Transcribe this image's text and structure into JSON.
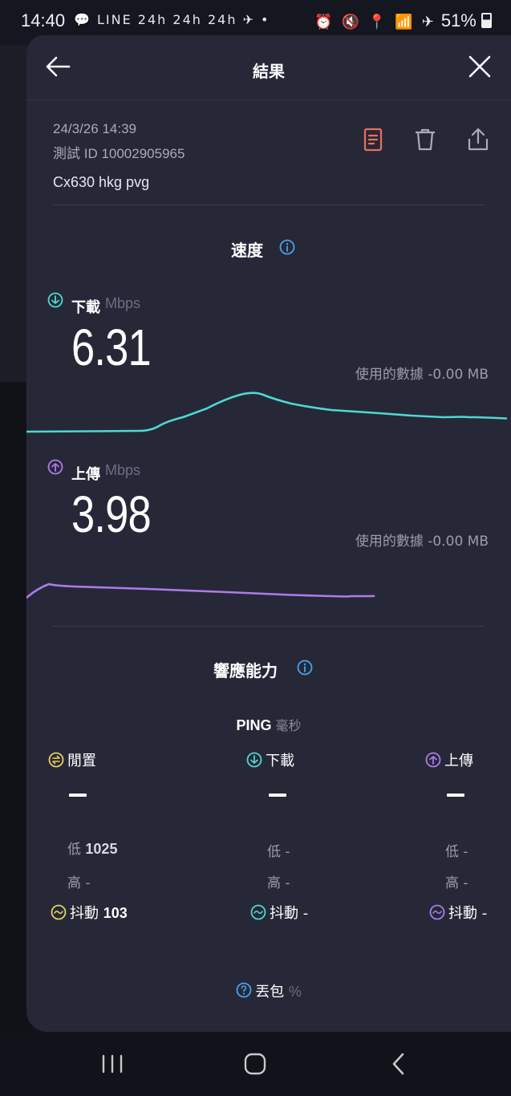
{
  "status_bar": {
    "time": "14:40",
    "notification_icons": "💬 LINE 24h 24h 24h ✈ •",
    "right_icons": "⏰ 🔇 📍 📶 ✈",
    "battery": "51%"
  },
  "header": {
    "title": "結果",
    "back_icon": "arrow-left-icon",
    "close_icon": "close-icon"
  },
  "result": {
    "date": "24/3/26 14:39",
    "test_id": "測試 ID 10002905965",
    "name": "Cx630 hkg pvg",
    "actions": [
      "document-icon",
      "trash-icon",
      "share-icon"
    ]
  },
  "speed": {
    "title": "速度",
    "download": {
      "label": "下載",
      "unit": "Mbps",
      "value": "6.31",
      "data_used": "使用的數據 -0.00 MB"
    },
    "upload": {
      "label": "上傳",
      "unit": "Mbps",
      "value": "3.98",
      "data_used": "使用的數據 -0.00 MB"
    }
  },
  "responsiveness": {
    "title": "響應能力",
    "ping_title": "PING",
    "ping_unit": "毫秒",
    "columns": [
      {
        "label": "閒置",
        "value": "",
        "low_label": "低",
        "low": "1025",
        "high_label": "高",
        "high": "-",
        "jitter_label": "抖動",
        "jitter": "103",
        "color": "#e8d25c"
      },
      {
        "label": "下載",
        "value": "",
        "low_label": "低",
        "low": "-",
        "high_label": "高",
        "high": "-",
        "jitter_label": "抖動",
        "jitter": "-",
        "color": "#4fd8d2"
      },
      {
        "label": "上傳",
        "value": "",
        "low_label": "低",
        "low": "-",
        "high_label": "高",
        "high": "-",
        "jitter_label": "抖動",
        "jitter": "-",
        "color": "#b07ae8"
      }
    ]
  },
  "packet_loss": {
    "label": "丟包",
    "unit": "%"
  },
  "colors": {
    "download": "#4fd8d2",
    "upload": "#b07ae8",
    "idle": "#e8d25c",
    "info": "#4aa3e8",
    "doc_accent": "#e8705c"
  }
}
